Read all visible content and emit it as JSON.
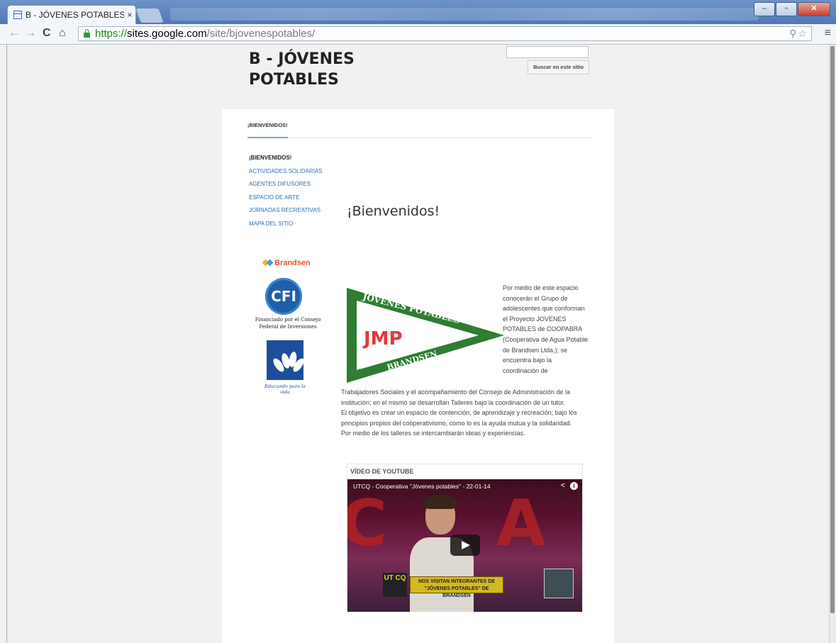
{
  "browser": {
    "tab_title": "B - JÓVENES POTABLES",
    "tab_close": "×",
    "url_scheme": "https://",
    "url_domain": "sites.google.com",
    "url_path": "/site/bjovenespotables/",
    "window_controls": [
      "minimize-icon",
      "maximize-icon",
      "close-icon"
    ]
  },
  "site": {
    "title": "B - JÓVENES POTABLES",
    "search_button": "Buscar en este sitio",
    "top_tab": "¡BIENVENIDOS!"
  },
  "sidebar": {
    "items": [
      {
        "label": "¡BIENVENIDOS!",
        "current": true
      },
      {
        "label": "ACTIVIDADES SOLIDARIAS",
        "current": false
      },
      {
        "label": "AGENTES DIFUSORES",
        "current": false
      },
      {
        "label": "ESPACIO DE ARTE",
        "current": false
      },
      {
        "label": "JORNADAS RECREATIVAS",
        "current": false
      },
      {
        "label": "MAPA DEL SITIO",
        "current": false
      }
    ],
    "brandsen_logo_text": "Brandsen",
    "cfi_logo_text": "CFI",
    "cfi_caption": "Financiado por el Consejo Federal de Inversiones",
    "edu_caption": "Educando para la vida"
  },
  "main": {
    "heading": "¡Bienvenidos!",
    "pennant_top": "JÓVENES POTABLES",
    "pennant_mid": "JMP",
    "pennant_bottom": "BRANDSEN",
    "intro_float": "Por medio de este espacio conocerán el Grupo de adolescentes que conforman el Proyecto JOVENES POTABLES de COOPABRA (Cooperativa de Agua Potable de Brandsen Ltda.); se encuentra bajo la coordinación  de",
    "paragraph_1": "Trabajadores Sociales y el acompañamiento del Consejo de Administración de la institución; en el mismo se desarrollan Talleres bajo la coordinación de un tutor.",
    "paragraph_2": "El objetivo es crear un espacio de contención, de aprendizaje y recreación; bajo los principios propios del cooperativismo, como lo es la ayuda mutua y la solidaridad.",
    "paragraph_3": "Por medio de los talleres se intercambiarán ideas y experiencias."
  },
  "youtube": {
    "label": "VÍDEO DE YOUTUBE",
    "video_title": "UTCQ - Cooperativa \"Jóvenes potables\" - 22-01-14",
    "lower_third_1": "NOS VISITAN INTEGRANTES DE",
    "lower_third_2": "\"JÓVENES POTABLES\" DE BRANDSEN",
    "channel_logo": "UT CQ"
  },
  "colors": {
    "link": "#2a6fb0",
    "pennant_green": "#2e7d32",
    "tab_underline": "#6fa5da"
  }
}
